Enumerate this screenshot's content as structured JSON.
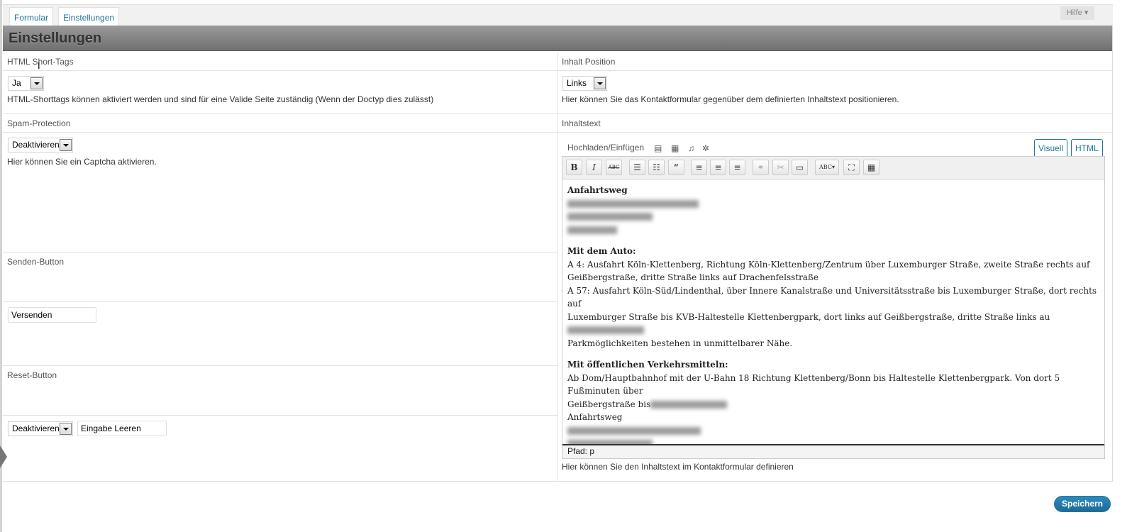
{
  "tabs": {
    "formular": "Formular",
    "einstellungen": "Einstellungen"
  },
  "help_label": "Hilfe ▾",
  "section_title": "Einstellungen",
  "settings": {
    "html_short_tags": {
      "label": "HTML Short-Tags",
      "value": "Ja",
      "description": "HTML-Shorttags können aktiviert werden und sind für eine Valide Seite zuständig (Wenn der Doctyp dies zulässt)"
    },
    "inhalt_position": {
      "label": "Inhalt Position",
      "value": "Links",
      "description": "Hier können Sie das Kontaktformular gegenüber dem definierten Inhaltstext positionieren."
    },
    "spam_protection": {
      "label": "Spam-Protection",
      "value": "Deaktivieren",
      "description": "Hier können Sie ein Captcha aktivieren."
    },
    "senden_button": {
      "label": "Senden-Button",
      "value": "Versenden"
    },
    "reset_button": {
      "label": "Reset-Button",
      "select_value": "Deaktivieren",
      "text_value": "Eingabe Leeren"
    },
    "inhaltstext": {
      "label": "Inhaltstext",
      "description": "Hier können Sie den Inhaltstext im Kontaktformular definieren"
    }
  },
  "editor": {
    "media_label": "Hochladen/Einfügen",
    "mode_visual": "Visuell",
    "mode_html": "HTML",
    "toolbar_icons": [
      "bold-icon",
      "italic-icon",
      "strikethrough-icon",
      "bullet-list-icon",
      "numbered-list-icon",
      "blockquote-icon",
      "align-left-icon",
      "align-center-icon",
      "align-right-icon",
      "link-icon",
      "unlink-icon",
      "more-tag-icon",
      "spellcheck-icon",
      "fullscreen-icon",
      "kitchen-sink-icon"
    ],
    "path": "Pfad: p",
    "content": {
      "heading1": "Anfahrtsweg",
      "heading2": "Mit dem Auto:",
      "auto_line1": "A 4: Ausfahrt Köln-Klettenberg, Richtung Köln-Klettenberg/Zentrum über Luxemburger Straße, zweite Straße rechts auf",
      "auto_line2": "Geißbergstraße, dritte Straße links auf Drachenfelsstraße",
      "auto_line3": "A 57: Ausfahrt Köln-Süd/Lindenthal, über Innere Kanalstraße und Universitätsstraße bis Luxemburger Straße, dort rechts auf",
      "auto_line4": "Luxemburger Straße bis KVB-Haltestelle Klettenbergpark, dort links auf Geißbergstraße, dritte Straße links au",
      "auto_line5": "Parkmöglichkeiten bestehen in unmittelbarer Nähe.",
      "heading3": "Mit öffentlichen Verkehrsmitteln:",
      "oepnv_line1": "Ab Dom/Hauptbahnhof mit der U-Bahn 18 Richtung Klettenberg/Bonn bis Haltestelle Klettenbergpark. Von dort 5 Fußminuten über",
      "oepnv_line2": "Geißbergstraße bis",
      "footer": "Anfahrtsweg"
    }
  },
  "save_label": "Speichern",
  "colors": {
    "link": "#21759b",
    "header_bg": "#7d7d7d",
    "save_btn": "#21759b"
  }
}
